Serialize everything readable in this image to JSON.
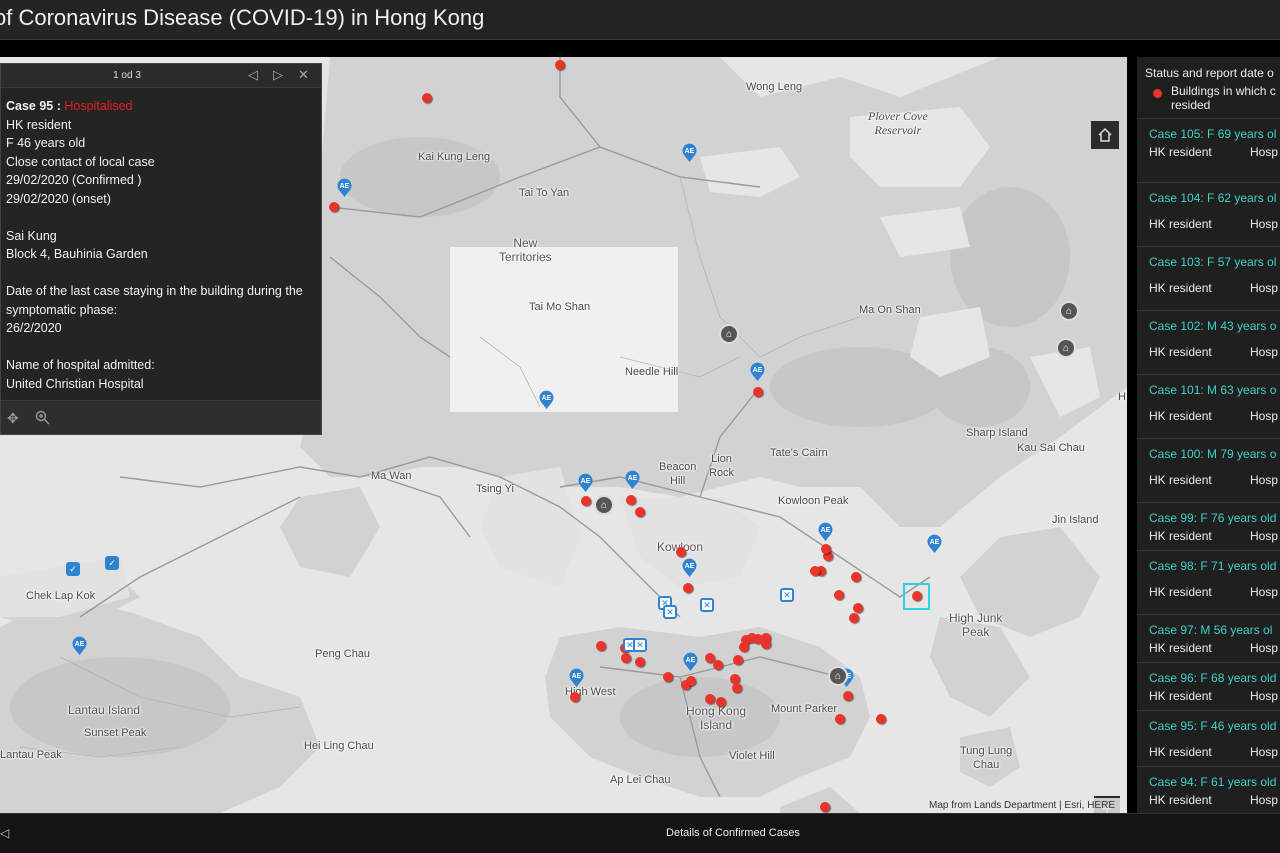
{
  "header": {
    "title": "of Coronavirus Disease (COVID-19) in Hong Kong"
  },
  "popup": {
    "page": "1 od 3",
    "case_label": "Case 95 :",
    "status": "Hospitalised",
    "status_color": "#e0201c",
    "lines": [
      "HK resident",
      "F 46 years old",
      "Close contact of local case",
      "29/02/2020 (Confirmed )",
      "29/02/2020 (onset)",
      "",
      "Sai Kung",
      "Block 4, Bauhinia Garden",
      "",
      "Date of the last case staying in the building during the symptomatic phase:",
      "26/2/2020",
      "",
      "Name of hospital admitted:",
      "United Christian Hospital"
    ],
    "icons": {
      "prev": "triangle-left-icon",
      "next": "triangle-right-icon",
      "close": "close-icon",
      "pan": "pan-icon",
      "zoom": "zoom-to-icon"
    }
  },
  "map": {
    "labels": {
      "wong_leng": "Wong Leng",
      "plover": "Plover Cove\nReservoir",
      "kai_kung_leng": "Kai Kung Leng",
      "tai_to_yan": "Tai To Yan",
      "new_territories": "New\nTerritories",
      "tai_mo_shan": "Tai Mo Shan",
      "ma_on_shan": "Ma On Shan",
      "needle_hill": "Needle Hill",
      "beacon_hill": "Beacon\nHill",
      "lion_rock": "Lion\nRock",
      "tates_cairn": "Tate's Cairn",
      "sharp_island": "Sharp Island",
      "kau_sai_chau": "Kau Sai Chau",
      "ma_wan": "Ma Wan",
      "tsing_yi": "Tsing Yi",
      "kowloon_peak": "Kowloon Peak",
      "jin_island": "Jin Island",
      "kowloon": "Kowloon",
      "chek_lap_kok": "Chek Lap Kok",
      "high_junk": "High Junk\nPeak",
      "peng_chau": "Peng Chau",
      "high_west": "High West",
      "hong_kong_island": "Hong Kong\nIsland",
      "mount_parker": "Mount Parker",
      "lantau_island": "Lantau Island",
      "sunset_peak": "Sunset Peak",
      "hei_ling_chau": "Hei Ling Chau",
      "violet_hill": "Violet Hill",
      "tung_lung": "Tung Lung\nChau",
      "lantau_peak": "Lantau Peak",
      "ap_lei_chau": "Ap Lei Chau",
      "h_edge": "H"
    },
    "ae_label": "AE",
    "attribution": "Map from Lands Department | Esri, HERE",
    "case_color": "#e8342a",
    "ae_color": "#2f83d0",
    "zoom_in": "+",
    "zoom_out": "−",
    "home_icon": "home-icon"
  },
  "legend": {
    "title": "Status and report date o",
    "item": "Buildings in which c\nresided"
  },
  "cases": [
    {
      "title": "Case 105: F 69 years ol",
      "res": "HK resident",
      "status": "Hosp"
    },
    {
      "title": "Case 104: F 62 years ol",
      "res": "HK resident",
      "status": "Hosp"
    },
    {
      "title": "Case 103: F 57 years ol",
      "res": "HK resident",
      "status": "Hosp"
    },
    {
      "title": "Case 102: M 43 years o",
      "res": "HK resident",
      "status": "Hosp"
    },
    {
      "title": "Case 101: M 63 years o",
      "res": "HK resident",
      "status": "Hosp"
    },
    {
      "title": "Case 100: M 79 years o",
      "res": "HK resident",
      "status": "Hosp"
    },
    {
      "title": "Case 99: F 76 years old",
      "res": "HK resident",
      "status": "Hosp"
    },
    {
      "title": "Case 98: F 71 years old",
      "res": "HK resident",
      "status": "Hosp"
    },
    {
      "title": "Case 97: M 56 years ol",
      "res": "HK resident",
      "status": "Hosp"
    },
    {
      "title": "Case 96: F 68 years old",
      "res": "HK resident",
      "status": "Hosp"
    },
    {
      "title": "Case 95: F 46 years old",
      "res": "HK resident",
      "status": "Hosp"
    },
    {
      "title": "Case 94: F 61 years old",
      "res": "HK resident",
      "status": "Hosp"
    }
  ],
  "footer": {
    "title": "Details of Confirmed Cases",
    "arrow_icon": "collapse-arrow-icon"
  }
}
